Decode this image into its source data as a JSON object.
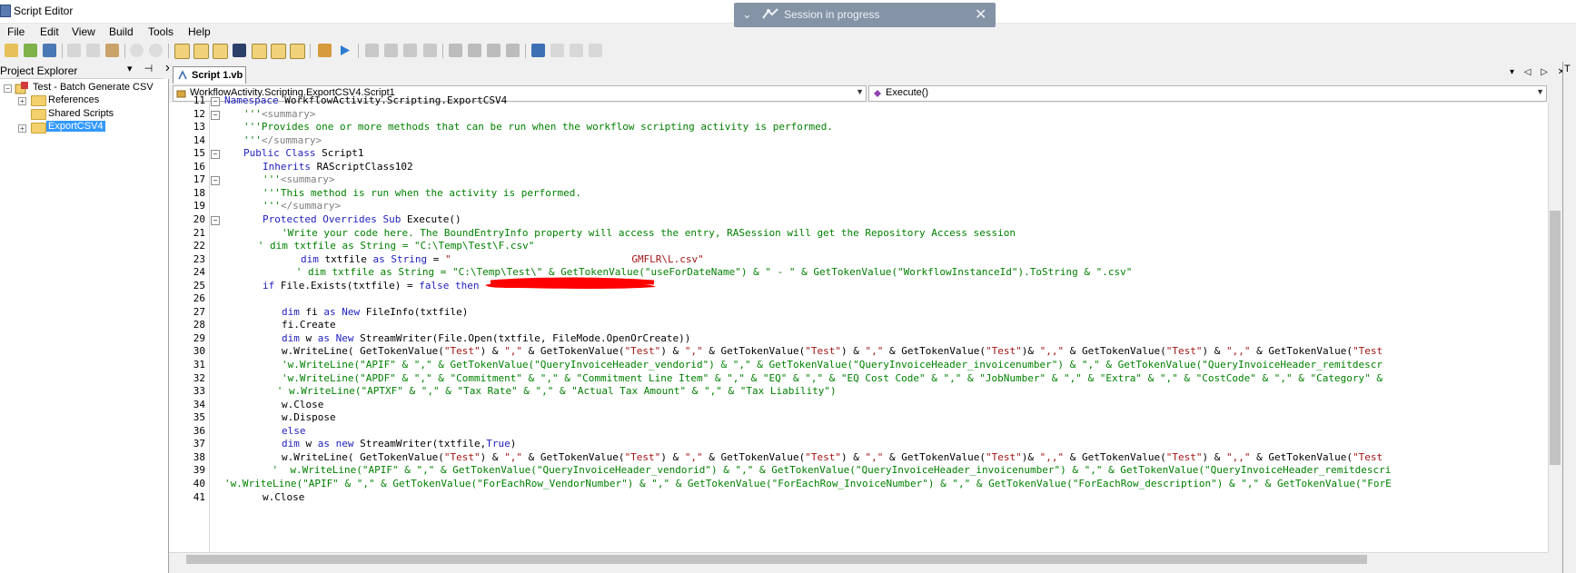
{
  "window": {
    "title": "Script Editor"
  },
  "session": {
    "text": "Session in progress",
    "collapse": "⌄",
    "close": "✕"
  },
  "menu": [
    "File",
    "Edit",
    "View",
    "Build",
    "Tools",
    "Help"
  ],
  "project_explorer": {
    "title": "Project Explorer",
    "controls": "▾ ⊣ ✕",
    "tree": {
      "root": "Test - Batch Generate CSV",
      "children": [
        "References",
        "Shared Scripts",
        "ExportCSV4"
      ]
    }
  },
  "tabs": [
    {
      "label": "Script 1.vb"
    }
  ],
  "tab_controls": "▾ ◁ ▷ ✕",
  "combos": {
    "class": "WorkflowActivity.Scripting.ExportCSV4.Script1",
    "method": "Execute()"
  },
  "right_pane": {
    "letter": "T"
  },
  "code_lines": [
    {
      "n": "11",
      "fold": "⊟",
      "indent": 0,
      "segs": [
        {
          "t": "Namespace ",
          "c": "kw"
        },
        {
          "t": "WorkflowActivity.Scripting.ExportCSV4",
          "c": ""
        }
      ]
    },
    {
      "n": "12",
      "fold": "⊟",
      "indent": 4,
      "segs": [
        {
          "t": "'''",
          "c": "cm"
        },
        {
          "t": "<summary>",
          "c": "gy"
        }
      ]
    },
    {
      "n": "13",
      "fold": "",
      "indent": 4,
      "segs": [
        {
          "t": "'''Provides one or more methods that can be run when the workflow scripting activity is performed.",
          "c": "cm"
        }
      ]
    },
    {
      "n": "14",
      "fold": "",
      "indent": 4,
      "segs": [
        {
          "t": "'''",
          "c": "cm"
        },
        {
          "t": "</summary>",
          "c": "gy"
        }
      ]
    },
    {
      "n": "15",
      "fold": "⊟",
      "indent": 4,
      "segs": [
        {
          "t": "Public Class ",
          "c": "kw"
        },
        {
          "t": "Script1",
          "c": ""
        }
      ]
    },
    {
      "n": "16",
      "fold": "",
      "indent": 8,
      "segs": [
        {
          "t": "Inherits ",
          "c": "kw"
        },
        {
          "t": "RAScriptClass102",
          "c": ""
        }
      ]
    },
    {
      "n": "17",
      "fold": "⊟",
      "indent": 8,
      "segs": [
        {
          "t": "'''",
          "c": "cm"
        },
        {
          "t": "<summary>",
          "c": "gy"
        }
      ]
    },
    {
      "n": "18",
      "fold": "",
      "indent": 8,
      "segs": [
        {
          "t": "'''This method is run when the activity is performed.",
          "c": "cm"
        }
      ]
    },
    {
      "n": "19",
      "fold": "",
      "indent": 8,
      "segs": [
        {
          "t": "'''",
          "c": "cm"
        },
        {
          "t": "</summary>",
          "c": "gy"
        }
      ]
    },
    {
      "n": "20",
      "fold": "⊟",
      "indent": 8,
      "segs": [
        {
          "t": "Protected Overrides Sub ",
          "c": "kw"
        },
        {
          "t": "Execute()",
          "c": ""
        }
      ]
    },
    {
      "n": "21",
      "fold": "",
      "indent": 12,
      "segs": [
        {
          "t": "'Write your code here. The BoundEntryInfo property will access the entry, RASession will get the Repository Access session",
          "c": "cm"
        }
      ]
    },
    {
      "n": "22",
      "fold": "",
      "indent": 7,
      "segs": [
        {
          "t": "' dim txtfile as String = \"C:\\Temp\\Test\\F.csv\"",
          "c": "cm"
        }
      ]
    },
    {
      "n": "23",
      "fold": "",
      "indent": 16,
      "segs": [
        {
          "t": "dim ",
          "c": "kw"
        },
        {
          "t": "txtfile ",
          "c": ""
        },
        {
          "t": "as String ",
          "c": "kw"
        },
        {
          "t": "= ",
          "c": ""
        },
        {
          "t": "\"                              GMFLR\\L.csv\"",
          "c": "st"
        }
      ]
    },
    {
      "n": "24",
      "fold": "",
      "indent": 15,
      "segs": [
        {
          "t": "' dim txtfile as String = \"C:\\Temp\\Test\\\" & GetTokenValue(\"useForDateName\") & \" - \" & GetTokenValue(\"WorkflowInstanceId\").ToString & \".csv\"",
          "c": "cm"
        }
      ]
    },
    {
      "n": "25",
      "fold": "",
      "indent": 8,
      "segs": [
        {
          "t": "if ",
          "c": "kw"
        },
        {
          "t": "File.Exists(txtfile) = ",
          "c": ""
        },
        {
          "t": "false then",
          "c": "kw"
        }
      ]
    },
    {
      "n": "26",
      "fold": "",
      "indent": 0,
      "segs": [
        {
          "t": "",
          "c": ""
        }
      ]
    },
    {
      "n": "27",
      "fold": "",
      "indent": 12,
      "segs": [
        {
          "t": "dim ",
          "c": "kw"
        },
        {
          "t": "fi ",
          "c": ""
        },
        {
          "t": "as New ",
          "c": "kw"
        },
        {
          "t": "FileInfo(txtfile)",
          "c": ""
        }
      ]
    },
    {
      "n": "28",
      "fold": "",
      "indent": 12,
      "segs": [
        {
          "t": "fi.Create",
          "c": ""
        }
      ]
    },
    {
      "n": "29",
      "fold": "",
      "indent": 12,
      "segs": [
        {
          "t": "dim ",
          "c": "kw"
        },
        {
          "t": "w ",
          "c": ""
        },
        {
          "t": "as New ",
          "c": "kw"
        },
        {
          "t": "StreamWriter(File.Open(txtfile, FileMode.OpenOrCreate))",
          "c": ""
        }
      ]
    },
    {
      "n": "30",
      "fold": "",
      "indent": 12,
      "segs": [
        {
          "t": "w.WriteLine( GetTokenValue(",
          "c": ""
        },
        {
          "t": "\"Test\"",
          "c": "st"
        },
        {
          "t": ") & ",
          "c": ""
        },
        {
          "t": "\",\"",
          "c": "st"
        },
        {
          "t": " & GetTokenValue(",
          "c": ""
        },
        {
          "t": "\"Test\"",
          "c": "st"
        },
        {
          "t": ") & ",
          "c": ""
        },
        {
          "t": "\",\"",
          "c": "st"
        },
        {
          "t": " & GetTokenValue(",
          "c": ""
        },
        {
          "t": "\"Test\"",
          "c": "st"
        },
        {
          "t": ") & ",
          "c": ""
        },
        {
          "t": "\",\"",
          "c": "st"
        },
        {
          "t": " & GetTokenValue(",
          "c": ""
        },
        {
          "t": "\"Test\"",
          "c": "st"
        },
        {
          "t": ")& ",
          "c": ""
        },
        {
          "t": "\",,\"",
          "c": "st"
        },
        {
          "t": " & GetTokenValue(",
          "c": ""
        },
        {
          "t": "\"Test\"",
          "c": "st"
        },
        {
          "t": ") & ",
          "c": ""
        },
        {
          "t": "\",,\"",
          "c": "st"
        },
        {
          "t": " & GetTokenValue(",
          "c": ""
        },
        {
          "t": "\"Test",
          "c": "st"
        }
      ]
    },
    {
      "n": "31",
      "fold": "",
      "indent": 12,
      "segs": [
        {
          "t": "'w.WriteLine(\"APIF\" & \",\" & GetTokenValue(\"QueryInvoiceHeader_vendorid\") & \",\" & GetTokenValue(\"QueryInvoiceHeader_invoicenumber\") & \",\" & GetTokenValue(\"QueryInvoiceHeader_remitdescr",
          "c": "cm"
        }
      ]
    },
    {
      "n": "32",
      "fold": "",
      "indent": 12,
      "segs": [
        {
          "t": "'w.WriteLine(\"APDF\" & \",\" & \"Commitment\" & \",\" & \"Commitment Line Item\" & \",\" & \"EQ\" & \",\" & \"EQ Cost Code\" & \",\" & \"JobNumber\" & \",\" & \"Extra\" & \",\" & \"CostCode\" & \",\" & \"Category\" &",
          "c": "cm"
        }
      ]
    },
    {
      "n": "33",
      "fold": "",
      "indent": 11,
      "segs": [
        {
          "t": "' w.WriteLine(\"APTXF\" & \",\" & \"Tax Rate\" & \",\" & \"Actual Tax Amount\" & \",\" & \"Tax Liability\")",
          "c": "cm"
        }
      ]
    },
    {
      "n": "34",
      "fold": "",
      "indent": 12,
      "segs": [
        {
          "t": "w.Close",
          "c": ""
        }
      ]
    },
    {
      "n": "35",
      "fold": "",
      "indent": 12,
      "segs": [
        {
          "t": "w.Dispose",
          "c": ""
        }
      ]
    },
    {
      "n": "36",
      "fold": "",
      "indent": 12,
      "segs": [
        {
          "t": "else",
          "c": "kw"
        }
      ]
    },
    {
      "n": "37",
      "fold": "",
      "indent": 12,
      "segs": [
        {
          "t": "dim ",
          "c": "kw"
        },
        {
          "t": "w ",
          "c": ""
        },
        {
          "t": "as new ",
          "c": "kw"
        },
        {
          "t": "StreamWriter(txtfile,",
          "c": ""
        },
        {
          "t": "True",
          "c": "kw"
        },
        {
          "t": ")",
          "c": ""
        }
      ]
    },
    {
      "n": "38",
      "fold": "",
      "indent": 12,
      "segs": [
        {
          "t": "w.WriteLine( GetTokenValue(",
          "c": ""
        },
        {
          "t": "\"Test\"",
          "c": "st"
        },
        {
          "t": ") & ",
          "c": ""
        },
        {
          "t": "\",\"",
          "c": "st"
        },
        {
          "t": " & GetTokenValue(",
          "c": ""
        },
        {
          "t": "\"Test\"",
          "c": "st"
        },
        {
          "t": ") & ",
          "c": ""
        },
        {
          "t": "\",\"",
          "c": "st"
        },
        {
          "t": " & GetTokenValue(",
          "c": ""
        },
        {
          "t": "\"Test\"",
          "c": "st"
        },
        {
          "t": ") & ",
          "c": ""
        },
        {
          "t": "\",\"",
          "c": "st"
        },
        {
          "t": " & GetTokenValue(",
          "c": ""
        },
        {
          "t": "\"Test\"",
          "c": "st"
        },
        {
          "t": ")& ",
          "c": ""
        },
        {
          "t": "\",,\"",
          "c": "st"
        },
        {
          "t": " & GetTokenValue(",
          "c": ""
        },
        {
          "t": "\"Test\"",
          "c": "st"
        },
        {
          "t": ") & ",
          "c": ""
        },
        {
          "t": "\",,\"",
          "c": "st"
        },
        {
          "t": " & GetTokenValue(",
          "c": ""
        },
        {
          "t": "\"Test",
          "c": "st"
        }
      ]
    },
    {
      "n": "39",
      "fold": "",
      "indent": 10,
      "segs": [
        {
          "t": "'  w.WriteLine(\"APIF\" & \",\" & GetTokenValue(\"QueryInvoiceHeader_vendorid\") & \",\" & GetTokenValue(\"QueryInvoiceHeader_invoicenumber\") & \",\" & GetTokenValue(\"QueryInvoiceHeader_remitdescri",
          "c": "cm"
        }
      ]
    },
    {
      "n": "40",
      "fold": "",
      "indent": 0,
      "segs": [
        {
          "t": "'w.WriteLine(\"APIF\" & \",\" & GetTokenValue(\"ForEachRow_VendorNumber\") & \",\" & GetTokenValue(\"ForEachRow_InvoiceNumber\") & \",\" & GetTokenValue(\"ForEachRow_description\") & \",\" & GetTokenValue(\"ForE",
          "c": "cm"
        }
      ]
    },
    {
      "n": "41",
      "fold": "",
      "indent": 8,
      "segs": [
        {
          "t": "w.Close",
          "c": ""
        }
      ]
    }
  ],
  "colors": {
    "keyword": "#1e1ebe",
    "comment": "#008000",
    "string": "#a31515",
    "tag": "#7f7f7f",
    "selection": "#3399ff"
  }
}
